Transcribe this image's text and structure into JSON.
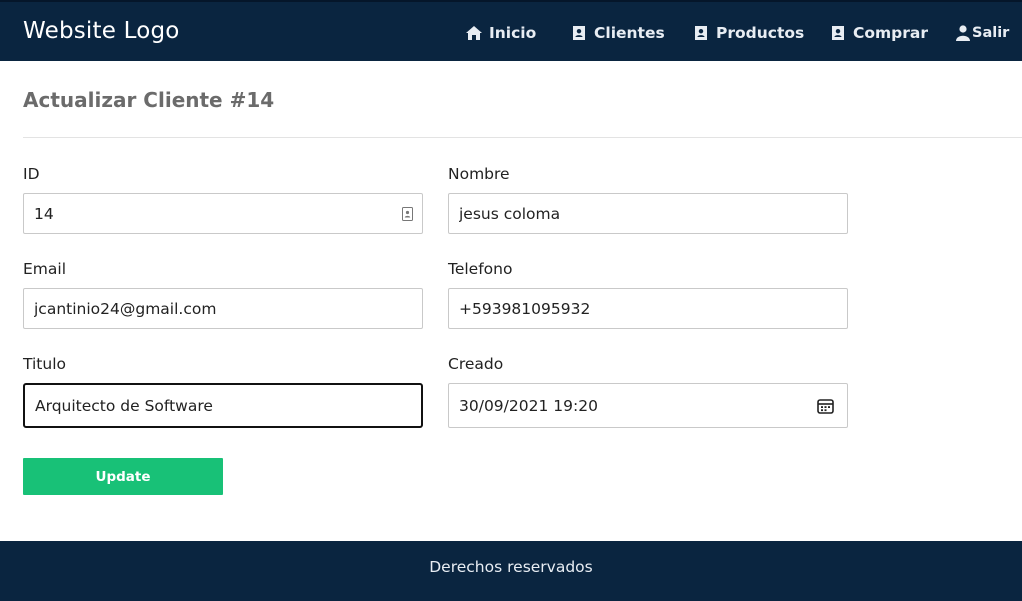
{
  "header": {
    "logo": "Website Logo",
    "nav": [
      {
        "label": "Inicio",
        "icon": "home-icon"
      },
      {
        "label": "Clientes",
        "icon": "address-book-icon"
      },
      {
        "label": "Productos",
        "icon": "address-book-icon"
      },
      {
        "label": "Comprar",
        "icon": "address-book-icon"
      },
      {
        "label": "Salir",
        "icon": "user-icon"
      }
    ]
  },
  "page": {
    "title": "Actualizar Cliente #14"
  },
  "form": {
    "id": {
      "label": "ID",
      "value": "14"
    },
    "nombre": {
      "label": "Nombre",
      "value": "jesus coloma"
    },
    "email": {
      "label": "Email",
      "value": "jcantinio24@gmail.com"
    },
    "telefono": {
      "label": "Telefono",
      "value": "+593981095932"
    },
    "titulo": {
      "label": "Titulo",
      "value": "Arquitecto de Software"
    },
    "creado": {
      "label": "Creado",
      "value": "30/09/2021 19:20"
    },
    "submit_label": "Update"
  },
  "footer": {
    "text": "Derechos reservados"
  },
  "colors": {
    "navbar_bg": "#0a2540",
    "button_bg": "#18c177",
    "title_text": "#6b6b6b"
  }
}
